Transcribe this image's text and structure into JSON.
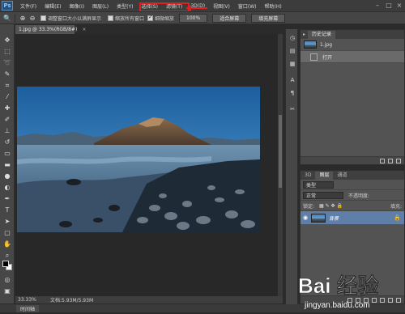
{
  "app": {
    "logo": "Ps"
  },
  "menu": [
    "文件(F)",
    "编辑(E)",
    "图像(I)",
    "图层(L)",
    "类型(Y)",
    "选择(S)",
    "滤镜(T)",
    "3D(D)",
    "视图(V)",
    "窗口(W)",
    "帮助(H)"
  ],
  "options": {
    "resize_windows": "调整窗口大小以满屏显示",
    "zoom_all": "缩放所有窗口",
    "scrubby_zoom": "细微缩放",
    "btn_100": "100%",
    "btn_fit": "适合屏幕",
    "btn_fill": "填充屏幕"
  },
  "document": {
    "tab_label": "1.jpg @ 33.3%(RGB/8#)",
    "close": "×",
    "zoom": "33.33%",
    "doc_size": "文档:5.93M/5.93M"
  },
  "bottom_tab": "时间轴",
  "history_panel": {
    "tabs": [
      "历史记录"
    ],
    "snapshot": "1.jpg",
    "states": [
      "打开"
    ]
  },
  "layers_panel": {
    "tabs": [
      "3D",
      "图层",
      "通道"
    ],
    "kind": "类型",
    "blend_mode": "正常",
    "opacity_label": "不透明度:",
    "lock_label": "锁定:",
    "fill_label": "填充:",
    "layer_name": "背景"
  },
  "watermark": {
    "text": "Bai 经验",
    "url": "jingyan.baidu.com"
  },
  "colors": {
    "highlight": "#e02020",
    "layer_selected": "#5f7fa8"
  }
}
